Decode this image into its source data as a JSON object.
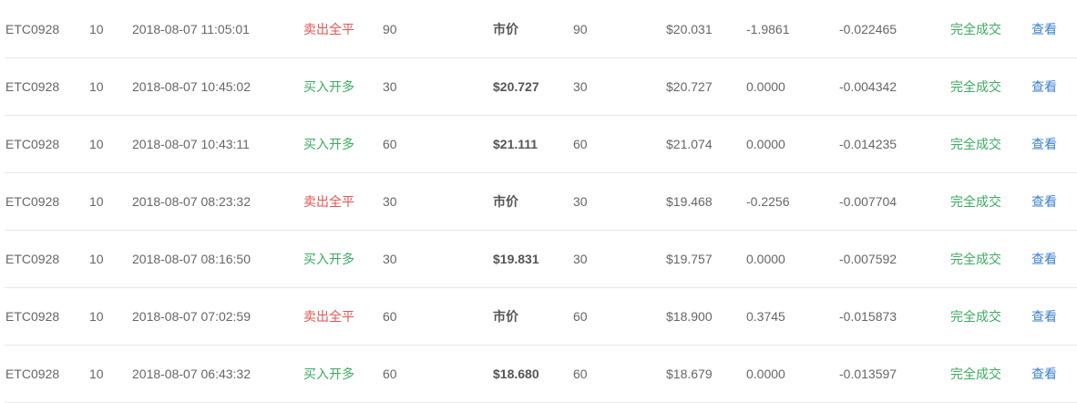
{
  "colors": {
    "sell": "#e55353",
    "buy": "#3dab62",
    "status": "#3dab62",
    "link": "#3a7fcf",
    "text": "#666666",
    "divider": "#e8e8e8"
  },
  "orders": [
    {
      "contract": "ETC0928",
      "leverage": "10",
      "time": "2018-08-07 11:05:01",
      "direction": "卖出全平",
      "side": "sell",
      "quantity": "90",
      "price": "市价",
      "filled": "90",
      "avg_price": "$20.031",
      "pnl": "-1.9861",
      "fee": "-0.022465",
      "status": "完全成交",
      "action": "查看"
    },
    {
      "contract": "ETC0928",
      "leverage": "10",
      "time": "2018-08-07 10:45:02",
      "direction": "买入开多",
      "side": "buy",
      "quantity": "30",
      "price": "$20.727",
      "filled": "30",
      "avg_price": "$20.727",
      "pnl": "0.0000",
      "fee": "-0.004342",
      "status": "完全成交",
      "action": "查看"
    },
    {
      "contract": "ETC0928",
      "leverage": "10",
      "time": "2018-08-07 10:43:11",
      "direction": "买入开多",
      "side": "buy",
      "quantity": "60",
      "price": "$21.111",
      "filled": "60",
      "avg_price": "$21.074",
      "pnl": "0.0000",
      "fee": "-0.014235",
      "status": "完全成交",
      "action": "查看"
    },
    {
      "contract": "ETC0928",
      "leverage": "10",
      "time": "2018-08-07 08:23:32",
      "direction": "卖出全平",
      "side": "sell",
      "quantity": "30",
      "price": "市价",
      "filled": "30",
      "avg_price": "$19.468",
      "pnl": "-0.2256",
      "fee": "-0.007704",
      "status": "完全成交",
      "action": "查看"
    },
    {
      "contract": "ETC0928",
      "leverage": "10",
      "time": "2018-08-07 08:16:50",
      "direction": "买入开多",
      "side": "buy",
      "quantity": "30",
      "price": "$19.831",
      "filled": "30",
      "avg_price": "$19.757",
      "pnl": "0.0000",
      "fee": "-0.007592",
      "status": "完全成交",
      "action": "查看"
    },
    {
      "contract": "ETC0928",
      "leverage": "10",
      "time": "2018-08-07 07:02:59",
      "direction": "卖出全平",
      "side": "sell",
      "quantity": "60",
      "price": "市价",
      "filled": "60",
      "avg_price": "$18.900",
      "pnl": "0.3745",
      "fee": "-0.015873",
      "status": "完全成交",
      "action": "查看"
    },
    {
      "contract": "ETC0928",
      "leverage": "10",
      "time": "2018-08-07 06:43:32",
      "direction": "买入开多",
      "side": "buy",
      "quantity": "60",
      "price": "$18.680",
      "filled": "60",
      "avg_price": "$18.679",
      "pnl": "0.0000",
      "fee": "-0.013597",
      "status": "完全成交",
      "action": "查看"
    }
  ]
}
